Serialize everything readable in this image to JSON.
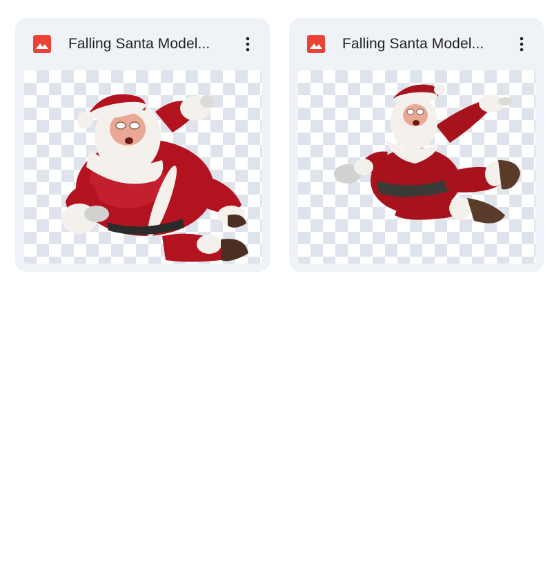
{
  "files": [
    {
      "title": "Falling Santa Model...",
      "icon": "image-file-icon",
      "menu_icon": "more-vert-icon",
      "thumbnail": "santa-falling-pose-1"
    },
    {
      "title": "Falling Santa Model...",
      "icon": "image-file-icon",
      "menu_icon": "more-vert-icon",
      "thumbnail": "santa-falling-pose-2"
    }
  ],
  "colors": {
    "card_background": "#eff2f7",
    "image_icon_red": "#ea4335",
    "checker": "#dfe3ec",
    "santa_red": "#b3131f",
    "fur_white": "#f4f1ec"
  }
}
